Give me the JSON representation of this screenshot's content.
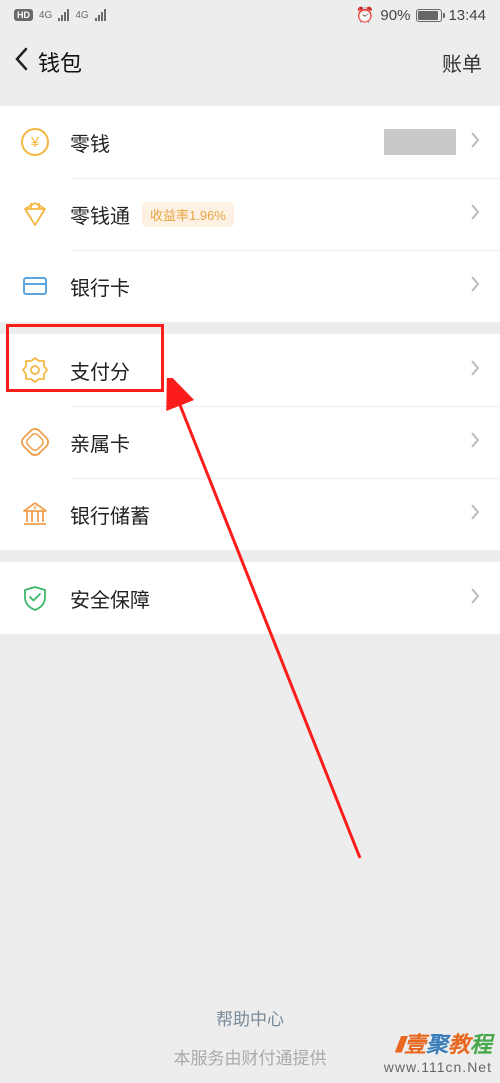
{
  "statusbar": {
    "hd": "HD",
    "net1": "4G",
    "net2": "4G",
    "battery_pct": "90%",
    "time": "13:44"
  },
  "header": {
    "title": "钱包",
    "right": "账单"
  },
  "groups": [
    {
      "items": [
        {
          "key": "balance",
          "label": "零钱",
          "has_hidden_value": true
        },
        {
          "key": "lqt",
          "label": "零钱通",
          "tag": "收益率1.96%"
        },
        {
          "key": "bankcard",
          "label": "银行卡"
        }
      ]
    },
    {
      "items": [
        {
          "key": "payscore",
          "label": "支付分"
        },
        {
          "key": "familycard",
          "label": "亲属卡"
        },
        {
          "key": "savings",
          "label": "银行储蓄"
        }
      ]
    },
    {
      "items": [
        {
          "key": "security",
          "label": "安全保障"
        }
      ]
    }
  ],
  "footer": {
    "help": "帮助中心",
    "provider": "本服务由财付通提供"
  },
  "watermark": {
    "brand": "壹聚教程",
    "url": "www.111cn.Net"
  }
}
